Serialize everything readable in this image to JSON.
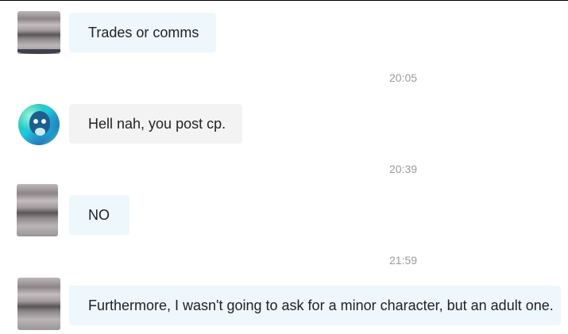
{
  "messages": [
    {
      "text": "Trades or comms",
      "sender": "self"
    },
    {
      "timestamp": "20:05",
      "text": "Hell nah, you post cp.",
      "sender": "other"
    },
    {
      "timestamp": "20:39",
      "text": "NO",
      "sender": "self"
    },
    {
      "timestamp": "21:59",
      "text": "Furthermore, I wasn't going to ask for a minor character, but an adult one.",
      "sender": "self"
    }
  ],
  "colors": {
    "self_bubble": "#eef7fb",
    "other_bubble": "#f3f3f3",
    "timestamp_text": "#9a9a9a",
    "message_text": "#222222"
  }
}
